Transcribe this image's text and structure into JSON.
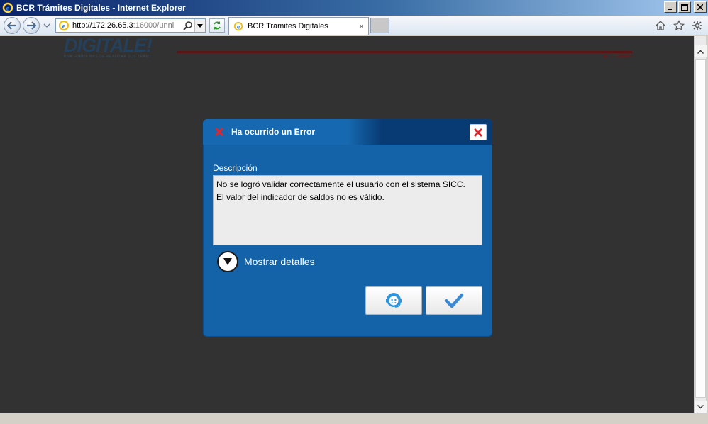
{
  "window": {
    "title": "BCR Trámites Digitales - Internet Explorer",
    "controls": [
      "minimize",
      "maximize",
      "close"
    ]
  },
  "navbar": {
    "url_host": "http://172.26.65.3",
    "url_port_path": ":16000/unni",
    "tab_title": "BCR Trámites Digitales",
    "tab_close": "×"
  },
  "page": {
    "logo_text": "DIGITALE!",
    "logo_subtitle": "UNA FORMA MÁS DE REALIZAR SUS TRÁM",
    "header_tag": "BCR Trámites"
  },
  "dialog": {
    "title": "Ha ocurrido un Error",
    "description_label": "Descripción",
    "description_lines": [
      "No se logró validar correctamente el usuario con el sistema SICC.",
      "El valor del indicador de saldos no es válido."
    ],
    "details_label": "Mostrar detalles"
  },
  "colors": {
    "dialog_bg": "#1463a8",
    "header_dark": "#083a73",
    "error_red": "#d9252b",
    "ok_check": "#3c8ad6",
    "page_overlay": "#323232"
  }
}
